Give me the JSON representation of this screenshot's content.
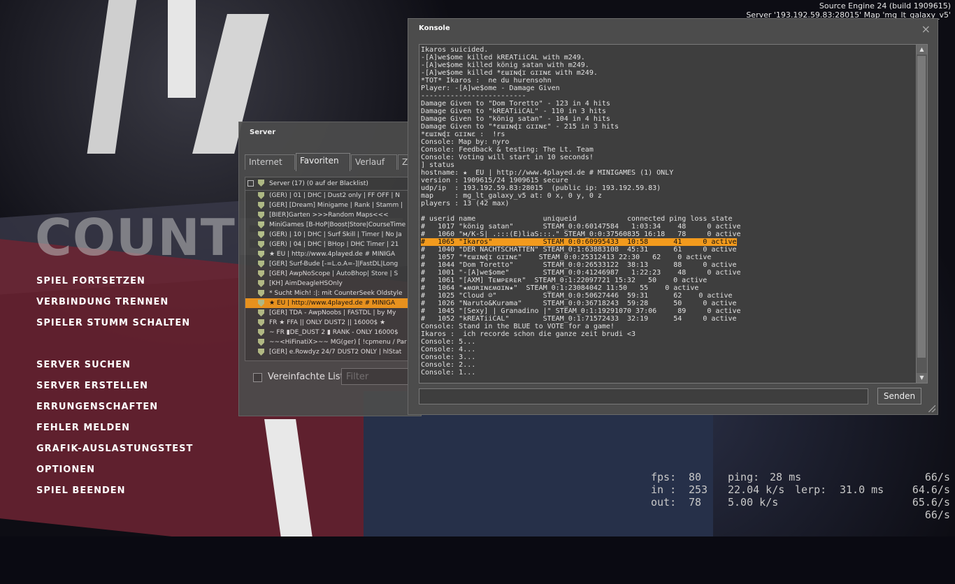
{
  "engine": {
    "line1": "Source Engine 24 (build 1909615)",
    "line2": "Server '193.192.59.83:28015' Map 'mg_lt_galaxy_v5'"
  },
  "logo_text": "COUNTER-STRIKE",
  "menu": {
    "group1": [
      "SPIEL FORTSETZEN",
      "VERBINDUNG TRENNEN",
      "SPIELER STUMM SCHALTEN"
    ],
    "group2": [
      "SERVER SUCHEN",
      "SERVER ERSTELLEN",
      "ERRUNGENSCHAFTEN",
      "FEHLER MELDEN",
      "GRAFIK-AUSLASTUNGSTEST",
      "OPTIONEN",
      "SPIEL BEENDEN"
    ]
  },
  "server_browser": {
    "title": "Server",
    "tabs": [
      "Internet",
      "Favoriten",
      "Verlauf",
      "Zu"
    ],
    "active_tab": "Favoriten",
    "header": "Server (17) (0 auf der Blacklist)",
    "rows": [
      "(GER) | 01 | DHC | Dust2 only | FF OFF | N",
      "[GER] [Dream] Minigame | Rank | Stamm |",
      "[BIER]Garten >>>Random Maps<<<",
      "MiniGames [B-HoP|Boost|Store|CourseTime",
      "(GER) | 10 | DHC | Surf Skill | Timer | No Ja",
      "(GER) | 04 | DHC | BHop | DHC Timer | 21",
      "★ EU | http://www.4played.de # MINIGA",
      "[GER] Surf-Bude [-=L.o.A=-]|FastDL|Long",
      "[GER] AwpNoScope | AutoBhop| Store | S",
      "[KH] AimDeagleHSOnly",
      "* Sucht Mich! :|: mit CounterSeek Oldstyle",
      "★ EU | http://www.4played.de # MINIGA",
      "[GER] TDA - AwpNoobs | FASTDL | by My",
      "FR ★ FFA || ONLY DUST2 || 16000$ ★",
      "~ FR ▮DE_DUST 2 ▮ RANK - ONLY 16000$",
      "~~<HiFinatiX>~~ MG(ger) [ !cpmenu / Par",
      "[GER] e.Rowdyz 24/7 DUST2 ONLY | hlStat"
    ],
    "selected_index": 11,
    "simple_list_label": "Vereinfachte Liste",
    "filter_placeholder": "Filter"
  },
  "console": {
    "title": "Konsole",
    "close_glyph": "×",
    "highlight_index": 27,
    "lines": [
      "Ikaros suicided.",
      "-[A]we$ome killed kREATiiCAL with m249.",
      "-[A]we$ome killed könig satan with m249.",
      "-[A]we$ome killed *ɛɯɪɴɖɪ ɢɪɪɴɛ with m249.",
      "*TOT* Ikaros :  ne du hurensohn",
      "Player: -[A]we$ome - Damage Given",
      "-------------------------",
      "Damage Given to \"Dom Toretto\" - 123 in 4 hits",
      "Damage Given to \"kREATiiCAL\" - 110 in 3 hits",
      "Damage Given to \"könig satan\" - 104 in 4 hits",
      "Damage Given to \"*ɛɯɪɴɖɪ ɢɪɪɴɛ\" - 215 in 3 hits",
      "*ɛɯɪɴɖɪ ɢɪɪɴɛ :  !rs",
      "Console: Map by: nyro",
      "Console: Feedback & testing: The Lt. Team",
      "Console: Voting will start in 10 seconds!",
      "] status",
      "hostname: ★  EU | http://www.4played.de # MINIGAMES (1) ONLY",
      "version : 1909615/24 1909615 secure",
      "udp/ip  : 193.192.59.83:28015  (public ip: 193.192.59.83)",
      "map     : mg_lt_galaxy_v5 at: 0 x, 0 y, 0 z",
      "players : 13 (42 max)",
      "",
      "# userid name                uniqueid            connected ping loss state",
      "#   1017 \"könig satan\"       STEAM_0:0:60147584   1:03:34    48     0 active",
      "#   1060 \"м/K-S| .:::(E)liaS:::.\" STEAM_0:0:37560835 16:18   78     0 active",
      "#   1065 \"Ikaros\"            STEAM_0:0:60995433  10:58      41     0 active",
      "#   1040 \"DER NACHTSCHATTEN\" STEAM_0:1:63883108  45:31      61     0 active",
      "#   1057 \"*ɛɯɪɴɖɪ ɢɪɪɴɛ\"    STEAM_0:0:25312413 22:30   62    0 active",
      "#   1044 \"Dom Toretto\"       STEAM_0:0:26533122  38:13      88     0 active",
      "#   1001 \"-[A]we$ome\"        STEAM_0:0:41246987   1:22:23    48     0 active",
      "#   1061 \"[AXM] Tᴇᴍᴘᴇʀᴇʀ\"  STEAM_0:1:22097721 15:32   50    0 active",
      "#   1064 \"★ʍɑʀɪɴɛʍɑɪɴ★\"  STEAM_0:1:23084042 11:50   55    0 active",
      "#   1025 \"Cloud ☺\"           STEAM_0:0:50627446  59:31      62    0 active",
      "#   1026 \"Naruto&Kurama\"     STEAM_0:0:36718243  59:28      50     0 active",
      "#   1045 \"[Sexy] | Granadino |\" STEAM_0:1:19291070 37:06     89     0 active",
      "#   1052 \"kREATiiCAL\"        STEAM_0:1:71572433  32:19      54     0 active",
      "Console: Stand in the BLUE to VOTE for a game!",
      "Ikaros :  ich recorde schon die ganze zeit brudi <3",
      "Console: 5...",
      "Console: 4...",
      "Console: 3...",
      "Console: 2...",
      "Console: 1..."
    ],
    "send_label": "Senden"
  },
  "netgraph": {
    "fps_label": "fps:",
    "fps": "80",
    "ping_label": "ping:",
    "ping": "28 ms",
    "rate1": "66/s",
    "in_label": "in :",
    "in_val": "253",
    "in_rate": "22.04 k/s",
    "lerp_label": "lerp:",
    "lerp": "31.0 ms",
    "rate2": "64.6/s",
    "out_label": "out:",
    "out_val": "78",
    "out_rate": "5.00 k/s",
    "rate3": "65.6/s",
    "rate4": "66/s"
  }
}
